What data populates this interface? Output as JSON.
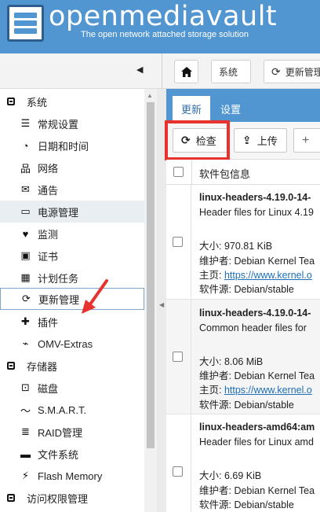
{
  "header": {
    "title": "openmediavault",
    "subtitle": "The open network attached storage solution"
  },
  "breadcrumb": {
    "items": [
      "系统",
      "更新管理"
    ]
  },
  "sidebar": {
    "items": [
      {
        "label": "系统",
        "icon": "system-square-icon",
        "type": "group"
      },
      {
        "label": "常规设置",
        "icon": "sliders-icon",
        "type": "child"
      },
      {
        "label": "日期和时间",
        "icon": "clock-icon",
        "type": "child"
      },
      {
        "label": "网络",
        "icon": "network-icon",
        "type": "child"
      },
      {
        "label": "通告",
        "icon": "envelope-icon",
        "type": "child"
      },
      {
        "label": "电源管理",
        "icon": "battery-icon",
        "type": "child"
      },
      {
        "label": "监测",
        "icon": "heartbeat-icon",
        "type": "child"
      },
      {
        "label": "证书",
        "icon": "certificate-icon",
        "type": "child"
      },
      {
        "label": "计划任务",
        "icon": "calendar-icon",
        "type": "child"
      },
      {
        "label": "更新管理",
        "icon": "refresh-icon",
        "type": "child",
        "selected": true
      },
      {
        "label": "插件",
        "icon": "puzzle-icon",
        "type": "child"
      },
      {
        "label": "OMV-Extras",
        "icon": "plug-icon",
        "type": "child"
      },
      {
        "label": "存储器",
        "icon": "storage-square-icon",
        "type": "group"
      },
      {
        "label": "磁盘",
        "icon": "disk-icon",
        "type": "child"
      },
      {
        "label": "S.M.A.R.T.",
        "icon": "pulse-icon",
        "type": "child"
      },
      {
        "label": "RAID管理",
        "icon": "raid-icon",
        "type": "child"
      },
      {
        "label": "文件系统",
        "icon": "folder-icon",
        "type": "child"
      },
      {
        "label": "Flash Memory",
        "icon": "flash-icon",
        "type": "child"
      },
      {
        "label": "访问权限管理",
        "icon": "access-square-icon",
        "type": "group"
      }
    ]
  },
  "tabs": {
    "active": "更新",
    "settings": "设置"
  },
  "actions": {
    "check": "检查",
    "upload": "上传",
    "add": "+"
  },
  "table": {
    "column": "软件包信息",
    "rows": [
      {
        "name": "linux-headers-4.19.0-14-",
        "desc": "Header files for Linux 4.19",
        "size": "大小: 970.81 KiB",
        "maintainer": "维护者: Debian Kernel Tea",
        "homepage_label": "主页: ",
        "homepage_link": "https://www.kernel.o",
        "source": "软件源: Debian/stable"
      },
      {
        "name": "linux-headers-4.19.0-14-",
        "desc": "Common header files for",
        "size": "大小: 8.06 MiB",
        "maintainer": "维护者: Debian Kernel Tea",
        "homepage_label": "主页: ",
        "homepage_link": "https://www.kernel.o",
        "source": "软件源: Debian/stable"
      },
      {
        "name": "linux-headers-amd64:am",
        "desc": "Header files for Linux amd",
        "size": "大小: 6.69 KiB",
        "maintainer": "维护者: Debian Kernel Tea",
        "homepage_label": "",
        "homepage_link": "",
        "source": "软件源: Debian/stable"
      }
    ]
  },
  "colors": {
    "brand": "#5196d0",
    "annotation": "#e8322e"
  }
}
